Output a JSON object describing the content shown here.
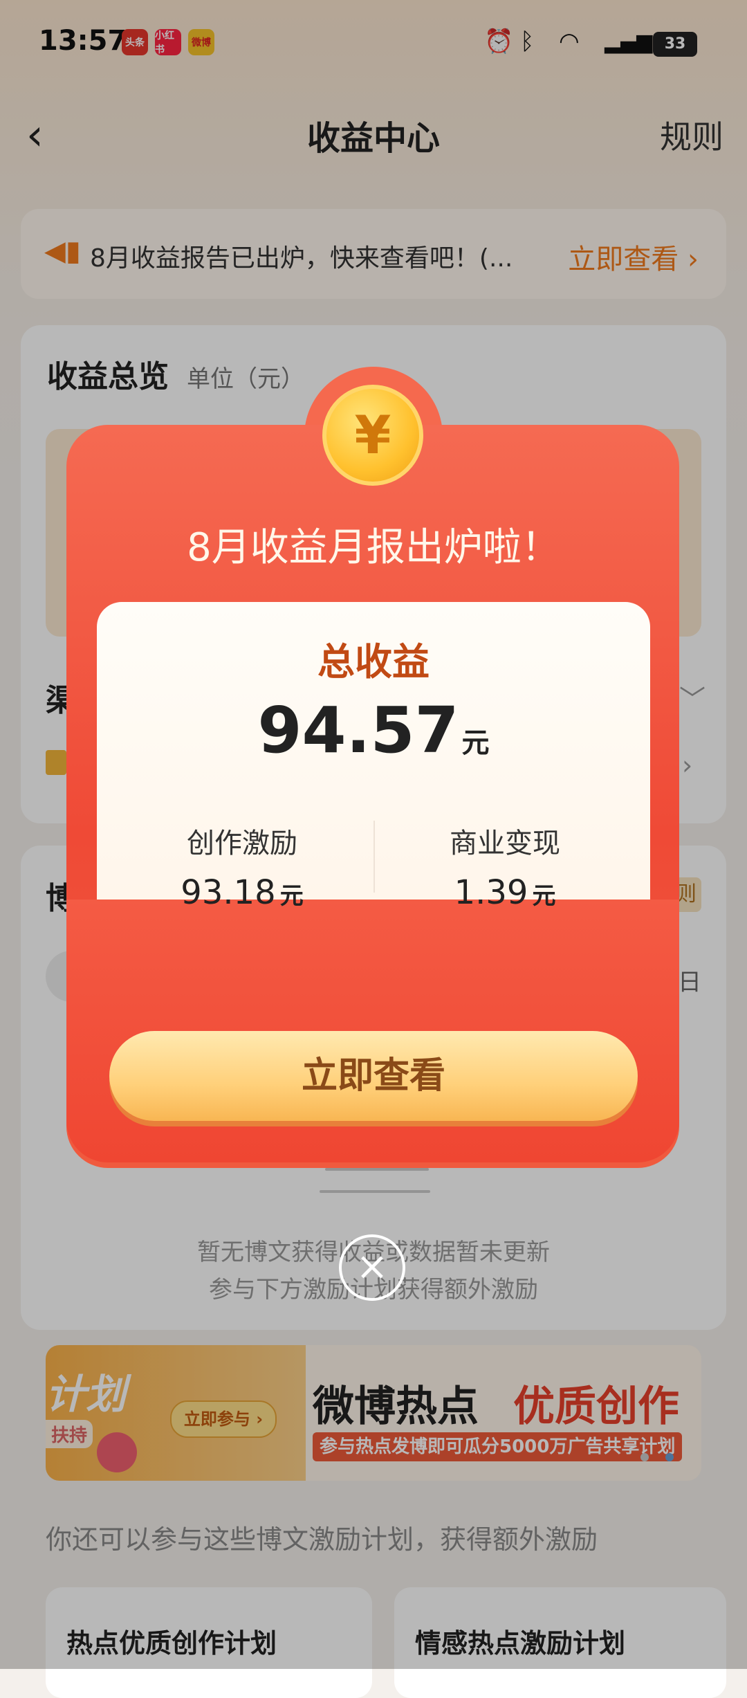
{
  "status": {
    "time": "13:57",
    "apps": [
      "头条",
      "小红书",
      "微博"
    ],
    "battery": "33"
  },
  "nav": {
    "title": "收益中心",
    "rules": "规则",
    "back": "‹"
  },
  "notice": {
    "text": "8月收益报告已出炉，快来查看吧！(...",
    "link": "立即查看 ›"
  },
  "overview": {
    "title": "收益总览",
    "unit": "单位（元）"
  },
  "background_rows": {
    "row1": "渠",
    "row2": "博",
    "date_frag": "日",
    "rules_badge": "则"
  },
  "empty": {
    "line1": "暂无博文获得收益或数据暂未更新",
    "line2": "参与下方激励计划获得额外激励"
  },
  "banner": {
    "left_title": "计划",
    "support": "扶持",
    "join": "立即参与 ›",
    "title_black": "微博热点",
    "title_red": "优质创作",
    "subtitle": "参与热点发博即可瓜分5000万广告共享计划"
  },
  "more": {
    "text": "你还可以参与这些博文激励计划，获得额外激励"
  },
  "plans": [
    {
      "title": "热点优质创作计划"
    },
    {
      "title": "情感热点激励计划"
    }
  ],
  "popup": {
    "coin_symbol": "¥",
    "heading": "8月收益月报出炉啦！",
    "total_label": "总收益",
    "total_value": "94.57",
    "total_unit": "元",
    "items": [
      {
        "label": "创作激励",
        "value": "93.18",
        "unit": "元"
      },
      {
        "label": "商业变现",
        "value": "1.39",
        "unit": "元"
      }
    ],
    "cta": "立即查看",
    "close": "×"
  },
  "colors": {
    "accent": "#f07a1e",
    "envelope": "#ef4a36",
    "coin": "#ffc12e"
  }
}
